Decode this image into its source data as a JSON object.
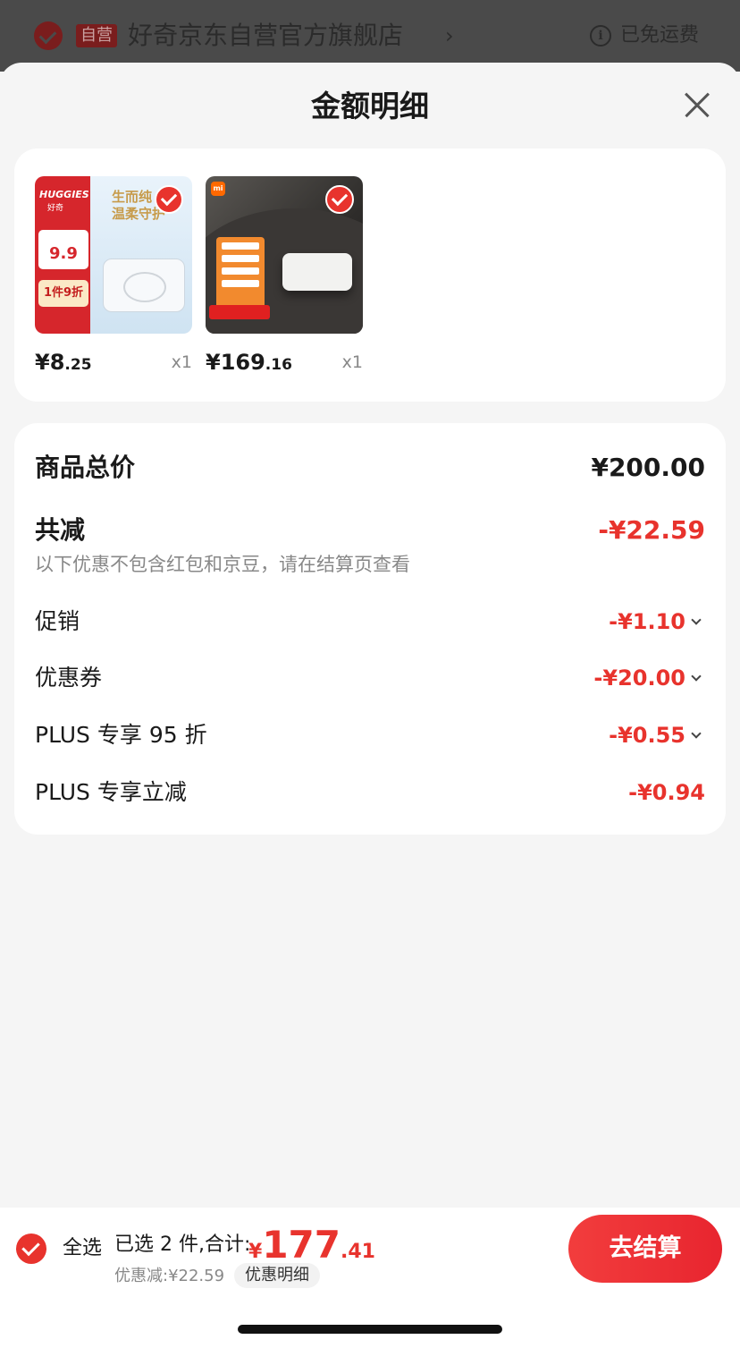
{
  "store": {
    "self_tag": "自营",
    "name": "好奇京东自营官方旗舰店",
    "arrow": "›",
    "info_icon": "i",
    "free_shipping": "已免运费"
  },
  "sheet": {
    "title": "金额明细"
  },
  "products": [
    {
      "price_int": "¥8",
      "price_dec": ".25",
      "qty": "x1",
      "image": "huggies-wipes",
      "selected": true
    },
    {
      "price_int": "¥169",
      "price_dec": ".16",
      "qty": "x1",
      "image": "xiaomi-router",
      "selected": true
    }
  ],
  "product_art": {
    "huggies_logo": "HUGGIES",
    "huggies_logo_cn": "好奇",
    "huggies_price": "9.9",
    "huggies_discount": "1件9折",
    "huggies_slogan_1": "生而纯",
    "huggies_slogan_2": "温柔守护",
    "mi_logo": "mi"
  },
  "summary": {
    "total_label": "商品总价",
    "total_value": "¥200.00",
    "reduce_label": "共减",
    "reduce_value": "-¥22.59",
    "note": "以下优惠不包含红包和京豆，请在结算页查看",
    "items": [
      {
        "label": "促销",
        "value": "-¥1.10",
        "expandable": true
      },
      {
        "label": "优惠券",
        "value": "-¥20.00",
        "expandable": true
      },
      {
        "label": "PLUS 专享 95 折",
        "value": "-¥0.55",
        "expandable": true
      },
      {
        "label": "PLUS 专享立减",
        "value": "-¥0.94",
        "expandable": false
      }
    ]
  },
  "bottom": {
    "select_all": "全选",
    "selected_text": "已选 2 件,合计:",
    "total_yen": "¥",
    "total_int": "177",
    "total_dec": ".41",
    "discount_text": "优惠减:¥22.59",
    "detail_link": "优惠明细",
    "checkout": "去结算"
  },
  "colors": {
    "accent_red": "#e8332d",
    "price_text": "#1a1a1a",
    "muted_text": "#888888"
  }
}
